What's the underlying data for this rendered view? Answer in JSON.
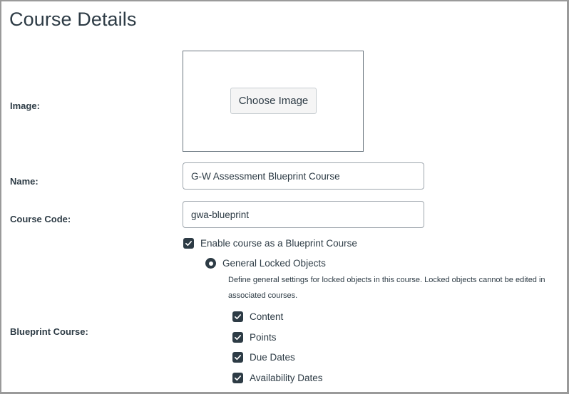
{
  "page": {
    "title": "Course Details"
  },
  "fields": {
    "image_label": "Image:",
    "choose_image_label": "Choose Image",
    "name_label": "Name:",
    "name_value": "G-W Assessment Blueprint Course",
    "course_code_label": "Course Code:",
    "course_code_value": "gwa-blueprint",
    "blueprint_label": "Blueprint Course:"
  },
  "blueprint": {
    "enable_label": "Enable course as a Blueprint Course",
    "enable_checked": true,
    "radio_label": "General Locked Objects",
    "radio_selected": true,
    "description": "Define general settings for locked objects in this course. Locked objects cannot be edited in associated courses.",
    "options": [
      {
        "label": "Content",
        "checked": true
      },
      {
        "label": "Points",
        "checked": true
      },
      {
        "label": "Due Dates",
        "checked": true
      },
      {
        "label": "Availability Dates",
        "checked": true
      }
    ]
  },
  "colors": {
    "text": "#2d3b45",
    "checkbox_fill": "#2d3b45",
    "input_border": "#9ea6ad"
  }
}
